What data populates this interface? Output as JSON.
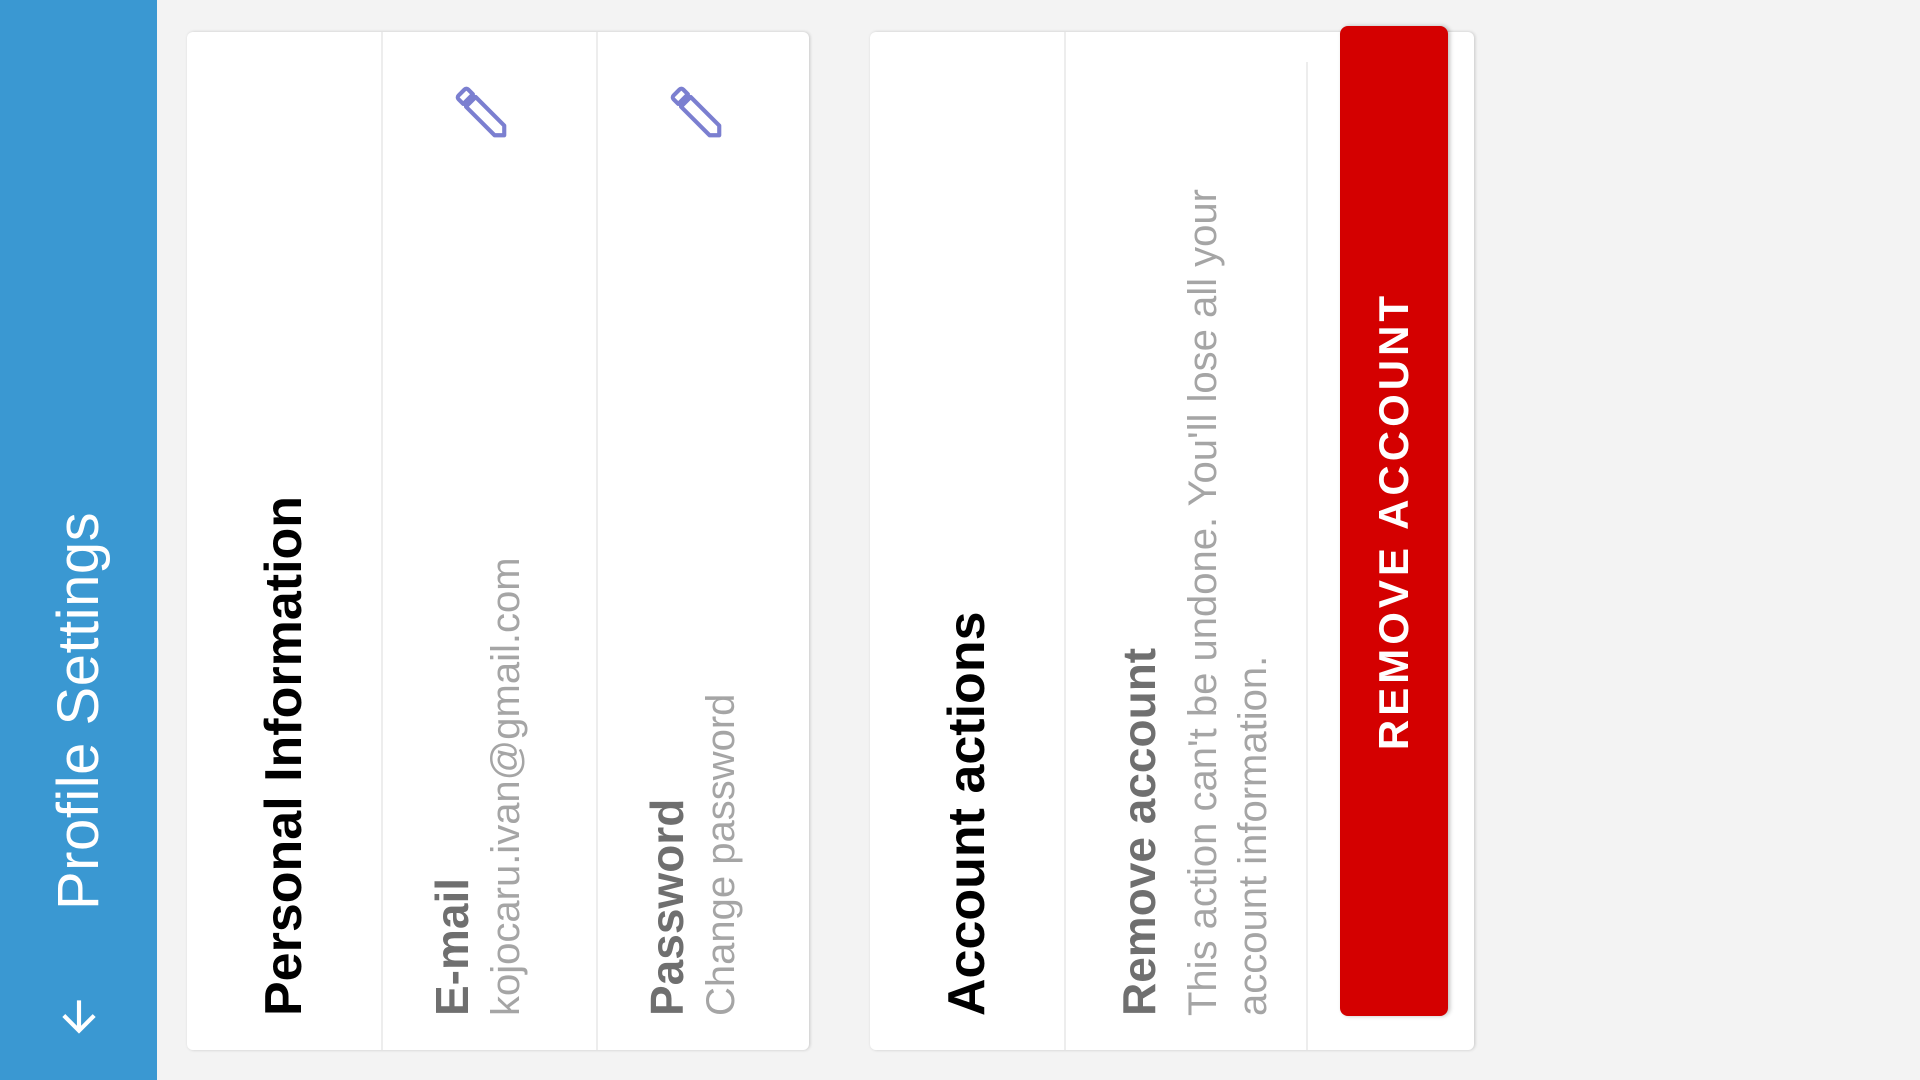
{
  "appbar": {
    "title": "Profile Settings",
    "back_icon": "arrow-back-icon"
  },
  "personal": {
    "title": "Personal Information",
    "rows": [
      {
        "label": "E-mail",
        "value": "kojocaru.ivan@gmail.com",
        "icon": "pencil-icon"
      },
      {
        "label": "Password",
        "value": "Change password",
        "icon": "pencil-icon"
      }
    ]
  },
  "actions": {
    "title": "Account actions",
    "remove_label": "Remove account",
    "remove_desc": "This action can't be undone. You'll lose all your account information.",
    "remove_button": "REMOVE ACCOUNT"
  },
  "colors": {
    "appbar": "#3a98d2",
    "danger": "#d40000",
    "icon": "#7b7fd0",
    "background": "#f3f3f3"
  }
}
